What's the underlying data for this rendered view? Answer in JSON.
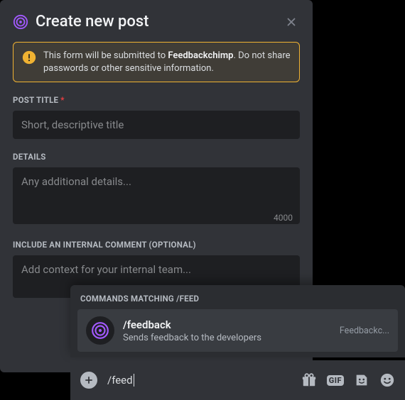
{
  "modal": {
    "title": "Create new post",
    "warning": {
      "pre": "This form will be submitted to ",
      "app": "Feedbackchimp",
      "post": ". Do not share passwords or other sensitive information."
    },
    "post_title": {
      "label": "POST TITLE",
      "required": "*",
      "placeholder": "Short, descriptive title"
    },
    "details": {
      "label": "DETAILS",
      "placeholder": "Any additional details...",
      "char_count": "4000"
    },
    "internal_comment": {
      "label": "INCLUDE AN INTERNAL COMMENT (OPTIONAL)",
      "placeholder": "Add context for your internal team..."
    }
  },
  "command_popup": {
    "header": "COMMANDS MATCHING /FEED",
    "item": {
      "name": "/feedback",
      "desc": "Sends feedback to the developers",
      "app": "Feedbackc..."
    }
  },
  "chat": {
    "input_text": "/feed"
  },
  "colors": {
    "accent": "#a259ff",
    "warning": "#f0b232"
  },
  "icons": {
    "target": "target-icon",
    "close": "close-icon",
    "warning": "warning-icon",
    "plus": "plus-icon",
    "gift": "gift-icon",
    "gif": "gif-icon",
    "sticker": "sticker-icon",
    "smile": "smile-icon"
  }
}
